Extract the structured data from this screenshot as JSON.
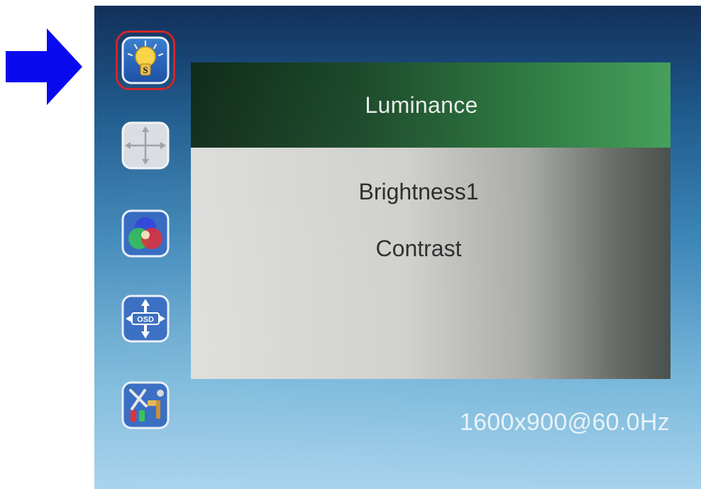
{
  "pointer": {
    "icon": "right-arrow-icon",
    "color": "#0a0aef"
  },
  "osd": {
    "menu_icons": [
      {
        "name": "luminance-bulb-icon",
        "selected": true,
        "badge": "S"
      },
      {
        "name": "image-position-icon",
        "selected": false
      },
      {
        "name": "color-setting-icon",
        "selected": false
      },
      {
        "name": "osd-position-icon",
        "selected": false,
        "badge": "OSD"
      },
      {
        "name": "tools-icon",
        "selected": false
      }
    ],
    "panel": {
      "title": "Luminance",
      "items": [
        "Brightness1",
        "Contrast"
      ]
    },
    "resolution": "1600x900@60.0Hz",
    "colors": {
      "header_dark": "#0f2b1a",
      "header_light": "#46a05c",
      "selection": "#d4232a",
      "background_top": "#12305a",
      "background_bottom": "#a6d2ec"
    }
  }
}
